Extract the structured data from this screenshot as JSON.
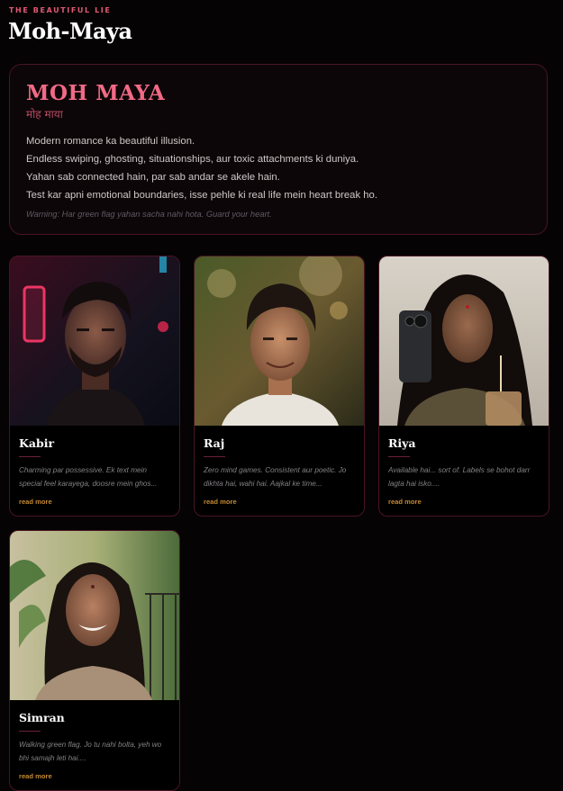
{
  "header": {
    "eyebrow": "THE BEAUTIFUL LIE",
    "title": "Moh-Maya"
  },
  "hero": {
    "title": "MOH MAYA",
    "subtitle": "मोह माया",
    "lines": [
      "Modern romance ka beautiful illusion.",
      "Endless swiping, ghosting, situationships, aur toxic attachments ki duniya.",
      "Yahan sab connected hain, par sab andar se akele hain.",
      "Test kar apni emotional boundaries, isse pehle ki real life mein heart break ho."
    ],
    "warning": "Warning: Har green flag yahan sacha nahi hota. Guard your heart."
  },
  "cards": [
    {
      "name": "Kabir",
      "desc": "Charming par possessive. Ek text mein special feel karayega, doosre mein ghos...",
      "more": "read more",
      "photo_icon": "portrait-man-neon"
    },
    {
      "name": "Raj",
      "desc": "Zero mind games. Consistent aur poetic. Jo dikhta hai, wahi hai. Aajkal ke time...",
      "more": "read more",
      "photo_icon": "portrait-man-sunlight"
    },
    {
      "name": "Riya",
      "desc": "Available hai... sort of. Labels se bohot darr lagta hai isko....",
      "more": "read more",
      "photo_icon": "portrait-woman-phone"
    },
    {
      "name": "Simran",
      "desc": "Walking green flag. Jo tu nahi bolta, yeh wo bhi samajh leti hai....",
      "more": "read more",
      "photo_icon": "portrait-woman-smiling"
    }
  ],
  "colors": {
    "background": "#050304",
    "accent": "#f06a86",
    "border": "#4a1424",
    "link": "#c48a34"
  }
}
